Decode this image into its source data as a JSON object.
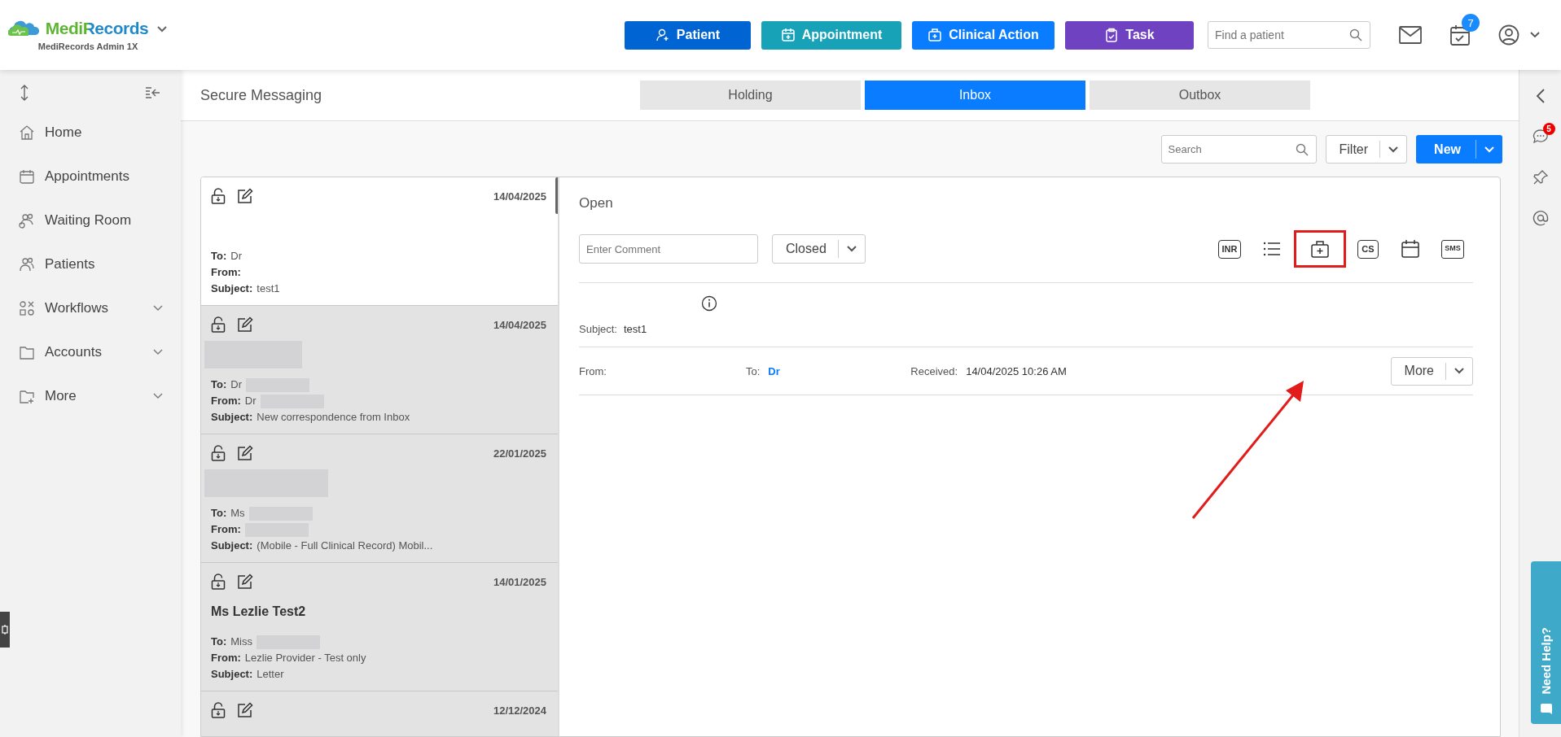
{
  "app": {
    "brand": "MediRecords",
    "account": "MediRecords Admin 1X"
  },
  "header_buttons": [
    {
      "label": "Patient",
      "kind": "patient",
      "color": "#0064d2"
    },
    {
      "label": "Appointment",
      "kind": "appointment",
      "color": "#17a2b8"
    },
    {
      "label": "Clinical Action",
      "kind": "clinical",
      "color": "#0a7cff"
    },
    {
      "label": "Task",
      "kind": "task",
      "color": "#6f42c1"
    }
  ],
  "patient_search": {
    "placeholder": "Find a patient"
  },
  "task_badge": "7",
  "sidebar": {
    "items": [
      {
        "label": "Home",
        "kind": "home",
        "expandable": false
      },
      {
        "label": "Appointments",
        "kind": "calendar",
        "expandable": false
      },
      {
        "label": "Waiting Room",
        "kind": "waiting",
        "expandable": false
      },
      {
        "label": "Patients",
        "kind": "people",
        "expandable": false
      },
      {
        "label": "Workflows",
        "kind": "workflow",
        "expandable": true
      },
      {
        "label": "Accounts",
        "kind": "folder",
        "expandable": true
      },
      {
        "label": "More",
        "kind": "folder-plus",
        "expandable": true
      }
    ]
  },
  "page_title": "Secure Messaging",
  "tabs": [
    {
      "label": "Holding",
      "selected": false
    },
    {
      "label": "Inbox",
      "selected": true
    },
    {
      "label": "Outbox",
      "selected": false
    }
  ],
  "toolbar": {
    "search_placeholder": "Search",
    "filter": "Filter",
    "new": "New"
  },
  "messages": [
    {
      "selected": true,
      "date": "14/04/2025",
      "name_redacted": false,
      "fields": [
        {
          "label": "To:",
          "value": "Dr",
          "redacted": false
        },
        {
          "label": "From:",
          "redacted": false
        },
        {
          "label": "Subject:",
          "value": "test1",
          "redacted": false
        }
      ]
    },
    {
      "selected": false,
      "date": "14/04/2025",
      "name_redacted": true,
      "fields": [
        {
          "label": "To:",
          "value": "Dr",
          "redacted": true
        },
        {
          "label": "From:",
          "value": "Dr",
          "redacted": true
        },
        {
          "label": "Subject:",
          "value": "New correspondence from Inbox",
          "redacted": false
        }
      ]
    },
    {
      "selected": false,
      "date": "22/01/2025",
      "name_redacted": true,
      "fields": [
        {
          "label": "To:",
          "value": "Ms",
          "redacted": true
        },
        {
          "label": "From:",
          "redacted": true
        },
        {
          "label": "Subject:",
          "value": "(Mobile - Full Clinical Record) Mobil...",
          "redacted": false
        }
      ]
    },
    {
      "selected": false,
      "date": "14/01/2025",
      "name": "Ms Lezlie Test2",
      "name_redacted": false,
      "fields": [
        {
          "label": "To:",
          "value": "Miss",
          "redacted": true
        },
        {
          "label": "From:",
          "value": "Lezlie Provider - Test only",
          "redacted": false
        },
        {
          "label": "Subject:",
          "value": "Letter",
          "redacted": false
        }
      ]
    },
    {
      "selected": false,
      "date": "12/12/2024",
      "name_redacted": false
    }
  ],
  "detail": {
    "status": "Open",
    "comment_placeholder": "Enter Comment",
    "state_select": "Closed",
    "action_icons": [
      {
        "kind": "inr",
        "text": "INR",
        "highlighted": false
      },
      {
        "kind": "list",
        "highlighted": false
      },
      {
        "kind": "clinical",
        "highlighted": true
      },
      {
        "kind": "cs",
        "text": "CS",
        "highlighted": false
      },
      {
        "kind": "calendar",
        "highlighted": false
      },
      {
        "kind": "sms",
        "text": "SMS",
        "highlighted": false
      }
    ],
    "subject_label": "Subject:",
    "subject": "test1",
    "from_label": "From:",
    "to_label": "To:",
    "to": "Dr",
    "received_label": "Received:",
    "received": "14/04/2025 10:26 AM",
    "more": "More"
  },
  "right_rail": {
    "chat_badge": "5",
    "help": "Need Help?"
  }
}
